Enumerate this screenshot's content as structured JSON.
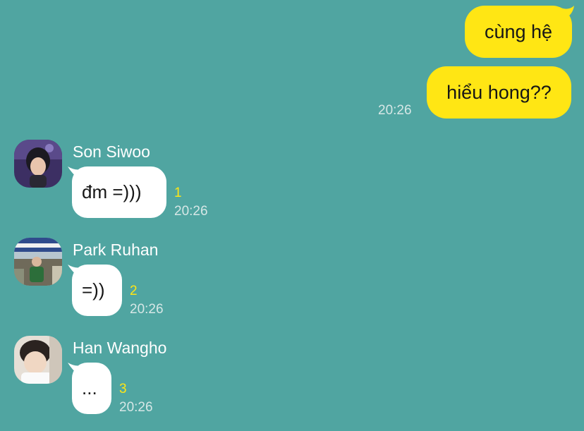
{
  "outgoing": [
    {
      "text": "cùng hệ"
    },
    {
      "text": "hiểu hong??",
      "time": "20:26"
    }
  ],
  "incoming": [
    {
      "sender": "Son Siwoo",
      "text": "đm =)))",
      "unread": "1",
      "time": "20:26"
    },
    {
      "sender": "Park Ruhan",
      "text": "=))",
      "unread": "2",
      "time": "20:26"
    },
    {
      "sender": "Han Wangho",
      "text": "...",
      "unread": "3",
      "time": "20:26"
    }
  ],
  "colors": {
    "background": "#50a5a1",
    "outgoing_bubble": "#ffe614",
    "incoming_bubble": "#ffffff",
    "unread_count": "#ffe614"
  }
}
